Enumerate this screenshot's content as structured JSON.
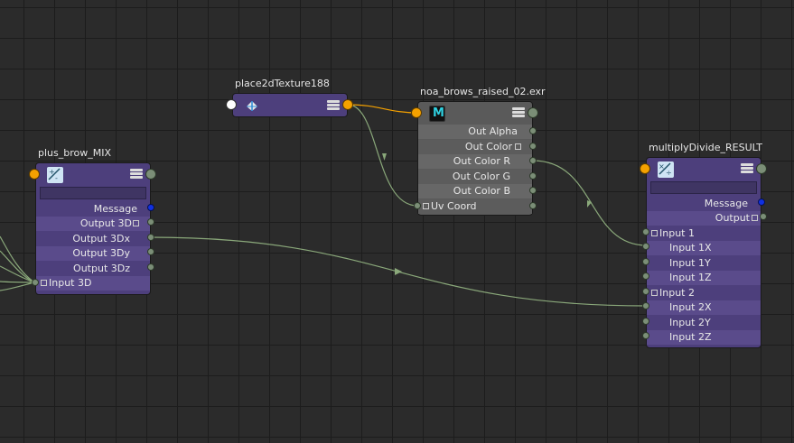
{
  "nodes": {
    "plus_brow_mix": {
      "title": "plus_brow_MIX",
      "icon": "plus-minus-average-icon",
      "attrs": [
        "Message",
        "Output 3D",
        "Output 3Dx",
        "Output 3Dy",
        "Output 3Dz",
        "Input 3D"
      ]
    },
    "place2d": {
      "title": "place2dTexture188",
      "icon": "place2d-texture-icon"
    },
    "file_node": {
      "title": "noa_brows_raised_02.exr",
      "icon_letter": "M",
      "attrs": [
        "Out Alpha",
        "Out Color",
        "Out Color R",
        "Out Color G",
        "Out Color B",
        "Uv Coord"
      ]
    },
    "multiply_divide": {
      "title": "multiplyDivide_RESULT",
      "icon": "multiply-divide-icon",
      "attrs": [
        "Message",
        "Output",
        "Input 1",
        "Input 1X",
        "Input 1Y",
        "Input 1Z",
        "Input 2",
        "Input 2X",
        "Input 2Y",
        "Input 2Z"
      ]
    }
  },
  "colors": {
    "grid_bg": "#2b2b2b",
    "node_purple": "#4d3f7c",
    "node_gray": "#5a5a5a",
    "wire_green": "#8aa87a",
    "wire_orange": "#f4a100",
    "plug_blue": "#1030e0"
  }
}
